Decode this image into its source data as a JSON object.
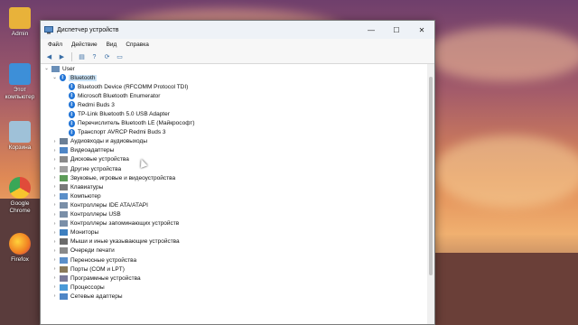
{
  "desktop": {
    "icons": [
      {
        "label": "Admin",
        "color": "#e8b23a"
      },
      {
        "label": "Этот компьютер",
        "color": "#3d8fd8"
      },
      {
        "label": "Корзина",
        "color": "#9fc1d8"
      },
      {
        "label": "Google Chrome",
        "color": "#e04b3a"
      },
      {
        "label": "Firefox",
        "color": "#f07e22"
      }
    ]
  },
  "window": {
    "title": "Диспетчер устройств",
    "controls": {
      "minimize": "—",
      "maximize": "☐",
      "close": "✕"
    }
  },
  "menu": [
    "Файл",
    "Действие",
    "Вид",
    "Справка"
  ],
  "toolbar": [
    "back-icon",
    "forward-icon",
    "properties-icon",
    "help-icon",
    "scan-icon",
    "monitor-icon"
  ],
  "tree": {
    "root": "User",
    "bluetooth": {
      "label": "Bluetooth",
      "children": [
        "Bluetooth Device (RFCOMM Protocol TDI)",
        "Microsoft Bluetooth Enumerator",
        "Redmi Buds 3",
        "TP-Link Bluetooth 5.0 USB Adapter",
        "Перечислитель Bluetooth LE (Майкрософт)",
        "Транспорт AVRCP Redmi Buds 3"
      ]
    },
    "categories": [
      "Аудиовходы и аудиовыходы",
      "Видеоадаптеры",
      "Дисковые устройства",
      "Другие устройства",
      "Звуковые, игровые и видеоустройства",
      "Клавиатуры",
      "Компьютер",
      "Контроллеры IDE ATA/ATAPI",
      "Контроллеры USB",
      "Контроллеры запоминающих устройств",
      "Мониторы",
      "Мыши и иные указывающие устройства",
      "Очереди печати",
      "Переносные устройства",
      "Порты (COM и LPT)",
      "Программные устройства",
      "Процессоры",
      "Сетевые адаптеры"
    ]
  }
}
